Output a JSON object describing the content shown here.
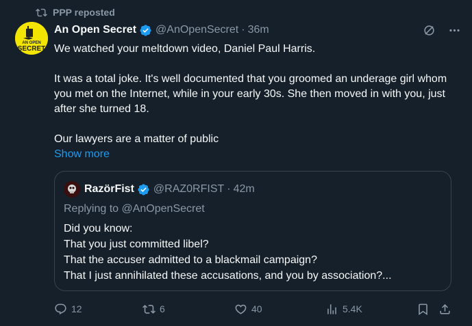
{
  "repost": {
    "label": "PPP reposted",
    "icon": "repost-icon"
  },
  "post": {
    "author_name": "An Open Secret",
    "handle": "@AnOpenSecret",
    "separator": "·",
    "time": "36m",
    "paragraphs": [
      "We watched your meltdown video, Daniel Paul Harris.",
      "It was a total joke.  It's well documented that you groomed an underage girl whom you met on the Internet, while in your early 30s.  She then moved in with you, just after she turned 18.",
      "Our lawyers are a matter of public"
    ],
    "show_more": "Show more",
    "avatar_text": "AN OPEN SECRET"
  },
  "quote": {
    "author_name": "RazörFist",
    "handle": "@RAZ0RFIST",
    "separator": "·",
    "time": "42m",
    "replying_to": "Replying to @AnOpenSecret",
    "lines": [
      "Did you know:",
      "That you just committed libel?",
      "That the accuser admitted to a blackmail campaign?",
      "That I just annihilated these accusations, and you by association?..."
    ]
  },
  "actions": {
    "replies": "12",
    "reposts": "6",
    "likes": "40",
    "views": "5.4K"
  },
  "colors": {
    "background": "#15202b",
    "accent": "#1d9bf0",
    "repost_green": "#00ba7c",
    "muted": "#8b98a5"
  }
}
